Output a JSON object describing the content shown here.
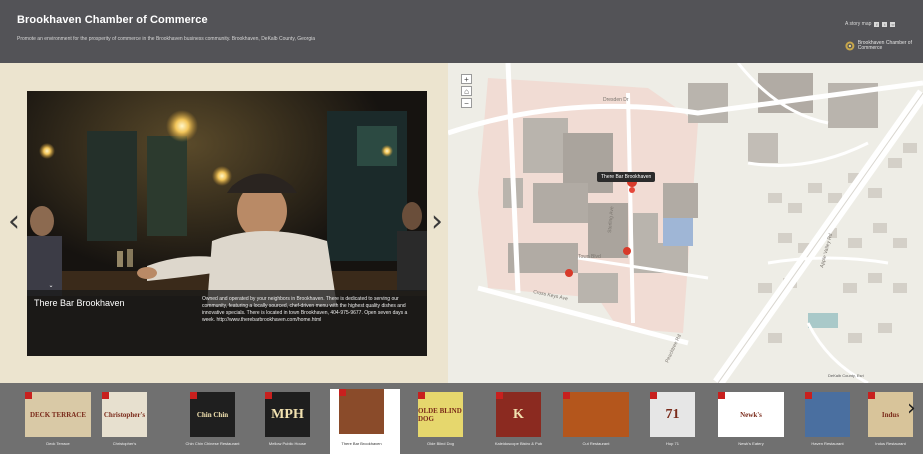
{
  "header": {
    "title": "Brookhaven Chamber of Commerce",
    "subtitle": "Promote an environment for the prosperity of commerce in the Brookhaven business community. Brookhaven, DeKalb County, Georgia",
    "share_label": "A story map",
    "logo_text": "Brookhaven Chamber of Commerce"
  },
  "feature": {
    "title": "There Bar Brookhaven",
    "description": "Owned and operated by your neighbors in Brookhaven. There is dedicated to serving our community, featuring a locally sourced, chef-driven menu with the highest quality dishes and innovative specials. There is located in town Brookhaven, 404-975-9677. Open seven days a week. http://www.therebarbrookhaven.com/home.html"
  },
  "nav": {
    "prev": "‹",
    "next": "›",
    "strip_next": "›"
  },
  "map": {
    "zoom_in": "+",
    "home": "⌂",
    "zoom_out": "−",
    "popup": "There Bar Brookhaven",
    "credit": "DeKalb County, Esri",
    "streets": [
      "Dresden Dr",
      "Peachtree Rd",
      "Town Blvd",
      "Apple Valley Rd",
      "Sterling Ave",
      "Cross Keys Ave"
    ]
  },
  "thumbnails": [
    {
      "label": "Deck Terrace",
      "bg": "#d9c9a6",
      "text": "DECK TERRACE"
    },
    {
      "label": "Christopher's",
      "bg": "#e7e0cf",
      "text": "Christopher's"
    },
    {
      "label": "Chin Chin Chinese Restaurant",
      "bg": "#1f1f1f",
      "text": "Chin Chin"
    },
    {
      "label": "Mellow Public House",
      "bg": "#1e1e1e",
      "text": "MPH"
    },
    {
      "label": "There Bar Brookhaven",
      "bg": "#8a4b2a",
      "text": ""
    },
    {
      "label": "Olde Blind Dog",
      "bg": "#e6d76d",
      "text": "OLDE BLIND DOG"
    },
    {
      "label": "Kaleidoscope Bistro & Pub",
      "bg": "#8b2a20",
      "text": "K"
    },
    {
      "label": "Cut Restaurant",
      "bg": "#b4561c",
      "text": ""
    },
    {
      "label": "Hop 71",
      "bg": "#e6e6e6",
      "text": "71"
    },
    {
      "label": "Newk's Eatery",
      "bg": "#ffffff",
      "text": "Newk's"
    },
    {
      "label": "Haven Restaurant",
      "bg": "#4a6fa0",
      "text": ""
    },
    {
      "label": "Indus Restaurant",
      "bg": "#d8c49a",
      "text": "Indus"
    }
  ]
}
